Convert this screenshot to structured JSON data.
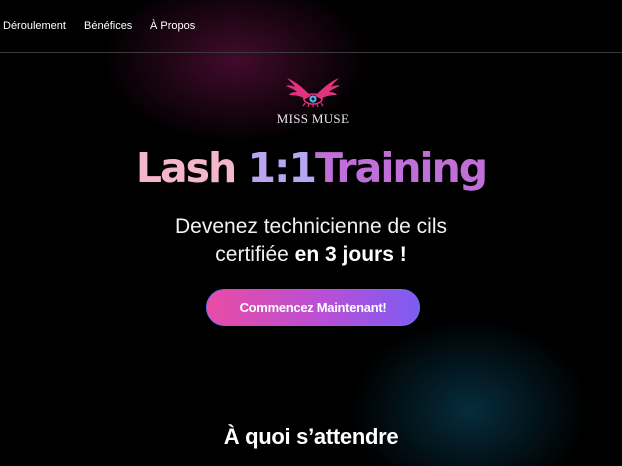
{
  "nav": {
    "items": [
      {
        "label": "Déroulement"
      },
      {
        "label": "Bénéfices"
      },
      {
        "label": "À Propos"
      }
    ]
  },
  "logo": {
    "icon": "winged-eye-icon",
    "text": "MISS MUSE"
  },
  "hero": {
    "title_part1": "Lash",
    "title_part2": "1:1",
    "title_part3": "Training",
    "subtitle_line1": "Devenez technicienne de cils",
    "subtitle_line2_prefix": "certifiée",
    "subtitle_line2_bold": "en 3 jours !",
    "cta_label": "Commencez Maintenant!"
  },
  "section": {
    "title": "À quoi s’attendre"
  },
  "colors": {
    "background": "#000000",
    "title_pink": "#f4b6c9",
    "title_lavender": "#b8a6f2",
    "title_purple": "#c06fd9",
    "cta_start": "#e94ca4",
    "cta_end": "#7d5cf2",
    "logo_magenta": "#e0337e"
  }
}
